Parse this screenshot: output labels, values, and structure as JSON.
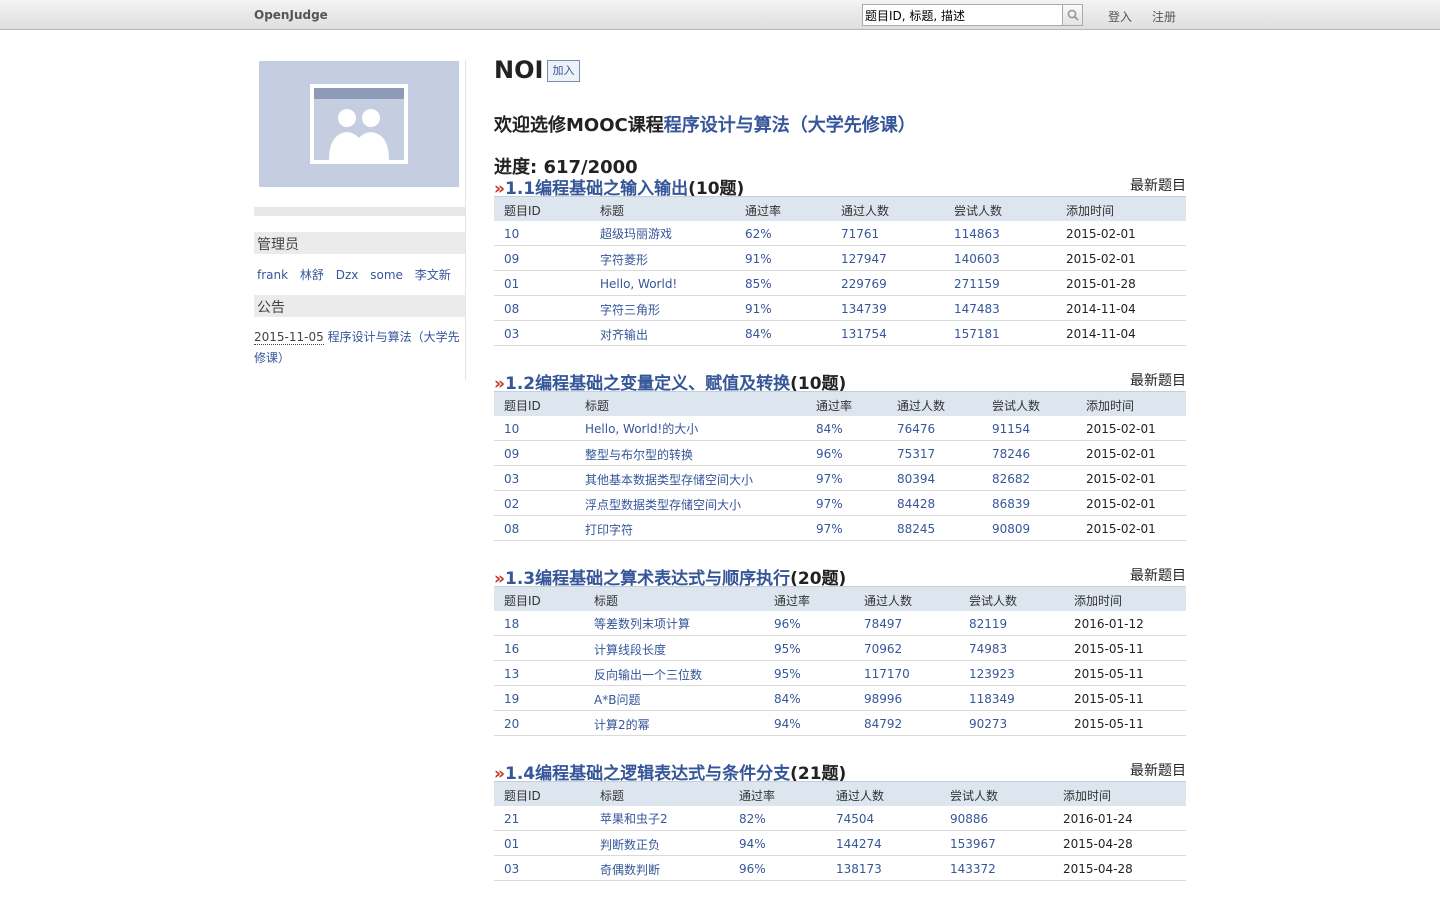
{
  "topbar": {
    "brand": "OpenJudge",
    "search_value": "题目ID, 标题, 描述",
    "login": "登入",
    "register": "注册"
  },
  "sidebar": {
    "admin_heading": "管理员",
    "admins": [
      "frank",
      "林舒",
      "Dzx",
      "some",
      "李文新"
    ],
    "notice_heading": "公告",
    "notice": {
      "date": "2015-11-05",
      "text": "程序设计与算法（大学先修课）"
    }
  },
  "main": {
    "group_name": "NOI",
    "join_label": "加入",
    "welcome_prefix": "欢迎选修MOOC课程",
    "welcome_link": "程序设计与算法（大学先修课）",
    "progress": "进度: 617/2000",
    "columns": [
      "题目ID",
      "标题",
      "通过率",
      "通过人数",
      "尝试人数",
      "添加时间"
    ],
    "latest_label": "最新题目",
    "sections": [
      {
        "raquo": "»",
        "title": "1.1编程基础之输入输出",
        "count": "(10题)",
        "rows": [
          [
            "10",
            "超级玛丽游戏",
            "62%",
            "71761",
            "114863",
            "2015-02-01"
          ],
          [
            "09",
            "字符菱形",
            "91%",
            "127947",
            "140603",
            "2015-02-01"
          ],
          [
            "01",
            "Hello, World!",
            "85%",
            "229769",
            "271159",
            "2015-01-28"
          ],
          [
            "08",
            "字符三角形",
            "91%",
            "134739",
            "147483",
            "2014-11-04"
          ],
          [
            "03",
            "对齐输出",
            "84%",
            "131754",
            "157181",
            "2014-11-04"
          ]
        ]
      },
      {
        "raquo": "»",
        "title": "1.2编程基础之变量定义、赋值及转换",
        "count": "(10题)",
        "rows": [
          [
            "10",
            "Hello, World!的大小",
            "84%",
            "76476",
            "91154",
            "2015-02-01"
          ],
          [
            "09",
            "整型与布尔型的转换",
            "96%",
            "75317",
            "78246",
            "2015-02-01"
          ],
          [
            "03",
            "其他基本数据类型存储空间大小",
            "97%",
            "80394",
            "82682",
            "2015-02-01"
          ],
          [
            "02",
            "浮点型数据类型存储空间大小",
            "97%",
            "84428",
            "86839",
            "2015-02-01"
          ],
          [
            "08",
            "打印字符",
            "97%",
            "88245",
            "90809",
            "2015-02-01"
          ]
        ]
      },
      {
        "raquo": "»",
        "title": "1.3编程基础之算术表达式与顺序执行",
        "count": "(20题)",
        "rows": [
          [
            "18",
            "等差数列末项计算",
            "96%",
            "78497",
            "82119",
            "2016-01-12"
          ],
          [
            "16",
            "计算线段长度",
            "95%",
            "70962",
            "74983",
            "2015-05-11"
          ],
          [
            "13",
            "反向输出一个三位数",
            "95%",
            "117170",
            "123923",
            "2015-05-11"
          ],
          [
            "19",
            "A*B问题",
            "84%",
            "98996",
            "118349",
            "2015-05-11"
          ],
          [
            "20",
            "计算2的幂",
            "94%",
            "84792",
            "90273",
            "2015-05-11"
          ]
        ]
      },
      {
        "raquo": "»",
        "title": "1.4编程基础之逻辑表达式与条件分支",
        "count": "(21题)",
        "rows": [
          [
            "21",
            "苹果和虫子2",
            "82%",
            "74504",
            "90886",
            "2016-01-24"
          ],
          [
            "01",
            "判断数正负",
            "94%",
            "144274",
            "153967",
            "2015-04-28"
          ],
          [
            "03",
            "奇偶数判断",
            "96%",
            "138173",
            "143372",
            "2015-04-28"
          ]
        ]
      }
    ]
  }
}
